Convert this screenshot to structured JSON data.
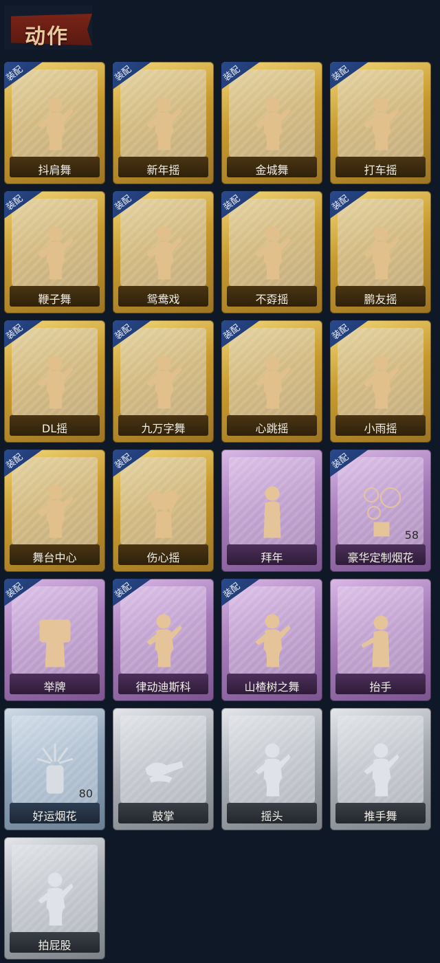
{
  "header": {
    "title": "动作"
  },
  "equip_label": "装配",
  "cards": [
    {
      "name": "抖肩舞",
      "tier": "gold",
      "equipped": true,
      "icon": "dancer-pose-icon"
    },
    {
      "name": "新年摇",
      "tier": "gold",
      "equipped": true,
      "icon": "dancer-pose-icon"
    },
    {
      "name": "金城舞",
      "tier": "gold",
      "equipped": true,
      "icon": "dancer-pose-icon"
    },
    {
      "name": "打车摇",
      "tier": "gold",
      "equipped": true,
      "icon": "dancer-pose-icon"
    },
    {
      "name": "鞭子舞",
      "tier": "gold",
      "equipped": true,
      "icon": "dancer-pose-icon"
    },
    {
      "name": "鸳鸯戏",
      "tier": "gold",
      "equipped": true,
      "icon": "dancer-pose-icon"
    },
    {
      "name": "不孬摇",
      "tier": "gold",
      "equipped": true,
      "icon": "dancer-pose-icon"
    },
    {
      "name": "鹏友摇",
      "tier": "gold",
      "equipped": true,
      "icon": "dancer-pose-icon"
    },
    {
      "name": "DL摇",
      "tier": "gold",
      "equipped": true,
      "icon": "dancer-pose-icon"
    },
    {
      "name": "九万字舞",
      "tier": "gold",
      "equipped": true,
      "icon": "dancer-pose-icon"
    },
    {
      "name": "心跳摇",
      "tier": "gold",
      "equipped": true,
      "icon": "dancer-pose-icon"
    },
    {
      "name": "小雨摇",
      "tier": "gold",
      "equipped": true,
      "icon": "dancer-pose-icon"
    },
    {
      "name": "舞台中心",
      "tier": "gold",
      "equipped": true,
      "icon": "dancer-pose-icon"
    },
    {
      "name": "伤心摇",
      "tier": "gold",
      "equipped": true,
      "icon": "heart-hands-icon"
    },
    {
      "name": "拜年",
      "tier": "purple",
      "equipped": false,
      "icon": "bow-greeting-icon"
    },
    {
      "name": "豪华定制烟花",
      "tier": "purple",
      "equipped": true,
      "icon": "fireworks-box-icon",
      "count": "58"
    },
    {
      "name": "举牌",
      "tier": "purple",
      "equipped": true,
      "icon": "hold-sign-icon"
    },
    {
      "name": "律动迪斯科",
      "tier": "purple",
      "equipped": true,
      "icon": "dancer-pose-icon"
    },
    {
      "name": "山楂树之舞",
      "tier": "purple",
      "equipped": true,
      "icon": "dancer-pose-icon"
    },
    {
      "name": "抬手",
      "tier": "purple",
      "equipped": false,
      "icon": "raise-hand-icon"
    },
    {
      "name": "好运烟花",
      "tier": "blue",
      "equipped": false,
      "icon": "firework-can-icon",
      "count": "80"
    },
    {
      "name": "鼓掌",
      "tier": "gray",
      "equipped": false,
      "icon": "clap-hands-icon"
    },
    {
      "name": "摇头",
      "tier": "gray",
      "equipped": false,
      "icon": "dancer-pose-icon"
    },
    {
      "name": "推手舞",
      "tier": "gray",
      "equipped": false,
      "icon": "dancer-pose-icon"
    },
    {
      "name": "拍屁股",
      "tier": "gray",
      "equipped": false,
      "icon": "dancer-pose-icon"
    }
  ],
  "colors": {
    "background": "#0f1826",
    "gold_tier": "#c79a2e",
    "purple_tier": "#a47bb8",
    "blue_tier": "#8ea3b8",
    "gray_tier": "#a8adb4",
    "equip_badge": "#1c3366",
    "header_ribbon": "#7a2417"
  }
}
